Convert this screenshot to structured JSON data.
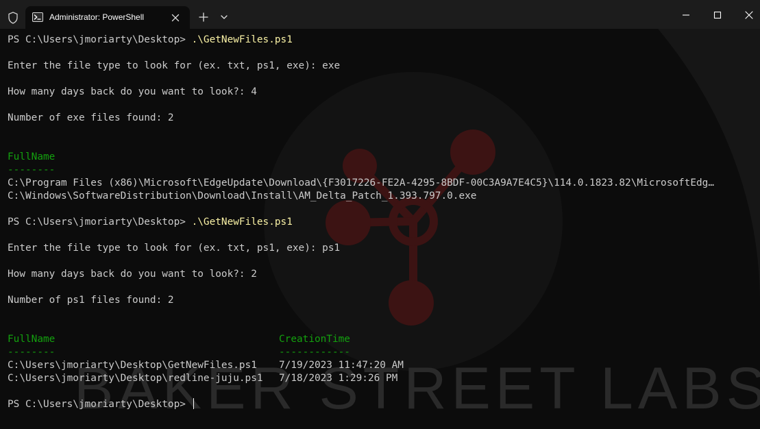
{
  "titlebar": {
    "tab_title": "Administrator: PowerShell",
    "new_tab_symbol": "+",
    "icons": [
      "shield-icon",
      "powershell-icon",
      "close-tab-icon",
      "new-tab-icon",
      "dropdown-chevron-icon",
      "minimize-icon",
      "maximize-icon",
      "close-window-icon"
    ]
  },
  "watermark": {
    "text": "BAKER STREET LABS"
  },
  "colors": {
    "background": "#0c0c0c",
    "titlebar": "#1c1c1c",
    "text": "#cccccc",
    "command": "#f9f1a5",
    "header": "#13a10e",
    "watermark": "#5a1414"
  },
  "console": {
    "run1": {
      "prompt": "PS C:\\Users\\jmoriarty\\Desktop> ",
      "command": ".\\GetNewFiles.ps1",
      "q_type": "Enter the file type to look for (ex. txt, ps1, exe): exe",
      "q_days": "How many days back do you want to look?: 4",
      "found": "Number of exe files found: 2",
      "header": "FullName",
      "underline": "--------",
      "rows": [
        "C:\\Program Files (x86)\\Microsoft\\EdgeUpdate\\Download\\{F3017226-FE2A-4295-8BDF-00C3A9A7E4C5}\\114.0.1823.82\\MicrosoftEdg…",
        "C:\\Windows\\SoftwareDistribution\\Download\\Install\\AM_Delta_Patch_1.393.797.0.exe"
      ]
    },
    "run2": {
      "prompt": "PS C:\\Users\\jmoriarty\\Desktop> ",
      "command": ".\\GetNewFiles.ps1",
      "q_type": "Enter the file type to look for (ex. txt, ps1, exe): ps1",
      "q_days": "How many days back do you want to look?: 2",
      "found": "Number of ps1 files found: 2",
      "header1": "FullName",
      "header2": "CreationTime",
      "underline1": "--------",
      "underline2": "------------",
      "rows": [
        {
          "fullname": "C:\\Users\\jmoriarty\\Desktop\\GetNewFiles.ps1",
          "creation": "7/19/2023 11:47:20 AM"
        },
        {
          "fullname": "C:\\Users\\jmoriarty\\Desktop\\redline-juju.ps1",
          "creation": "7/18/2023 1:29:26 PM"
        }
      ]
    },
    "final_prompt": "PS C:\\Users\\jmoriarty\\Desktop> "
  }
}
